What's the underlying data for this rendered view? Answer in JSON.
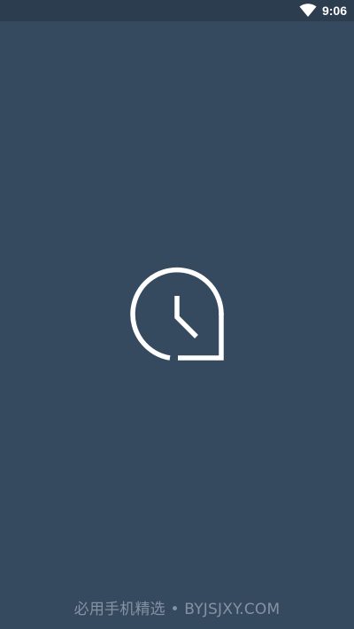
{
  "status_bar": {
    "time": "9:06",
    "wifi_icon": "wifi-icon"
  },
  "splash": {
    "logo_icon": "clock-chat-icon",
    "logo_color": "#ffffff",
    "background_color": "#364a5f"
  },
  "footer": {
    "watermark": "必用手机精选 • BYJSJXY.COM"
  }
}
